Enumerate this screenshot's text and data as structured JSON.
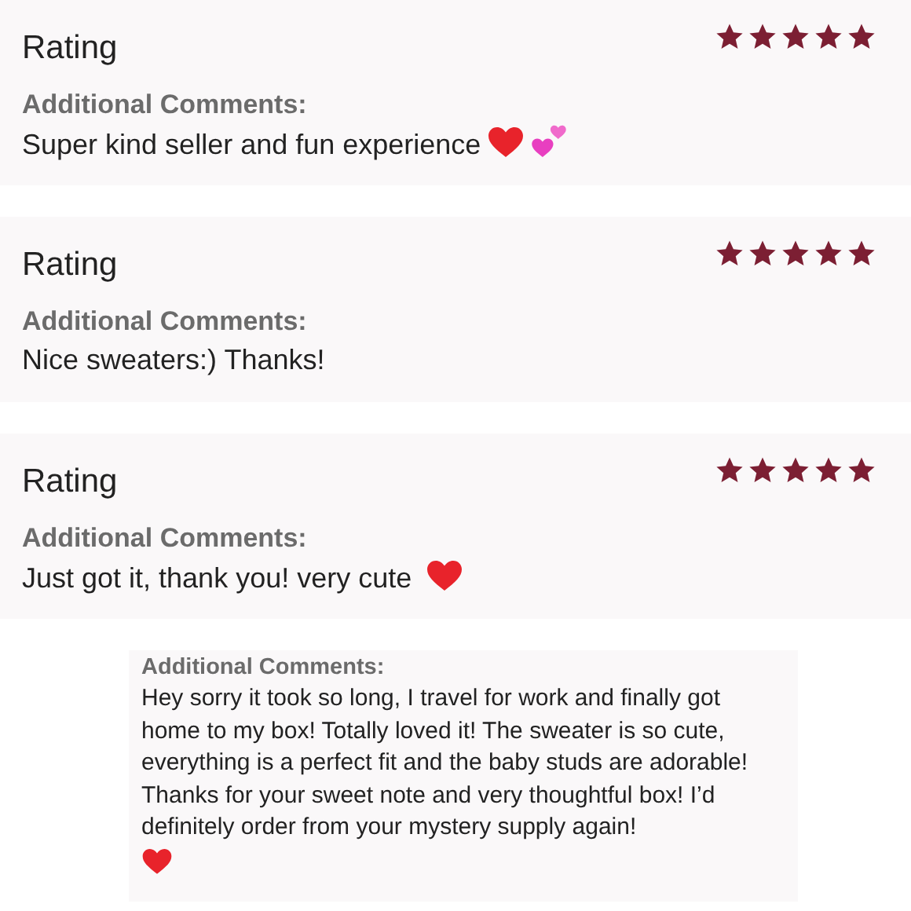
{
  "reviews": [
    {
      "title": "Rating",
      "stars": 5,
      "label": "Additional Comments:",
      "comment": "Super kind seller and fun experience",
      "emojis": [
        {
          "kind": "red-heart"
        },
        {
          "kind": "pink-hearts"
        }
      ]
    },
    {
      "title": "Rating",
      "stars": 5,
      "label": "Additional Comments:",
      "comment": "Nice sweaters:) Thanks!"
    },
    {
      "title": "Rating",
      "stars": 5,
      "label": "Additional Comments:",
      "comment": "Just got it, thank you! very cute ",
      "emojis": [
        {
          "kind": "red-heart"
        }
      ]
    }
  ],
  "note": {
    "label": "Additional Comments:",
    "comment": "Hey sorry it took so long, I travel for work and finally got home to my box! Totally loved it! The sweater is so cute, everything is a perfect fit and the baby studs are adorable! Thanks for your sweet note and very thoughtful box! I’d definitely order from your mystery supply again!",
    "emojis": [
      {
        "kind": "red-heart"
      }
    ]
  }
}
